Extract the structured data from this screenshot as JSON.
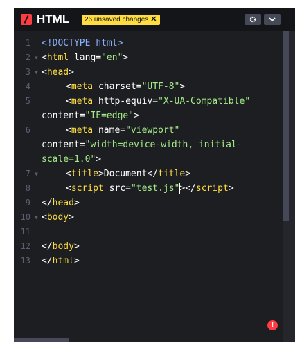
{
  "header": {
    "title": "HTML",
    "badge_text": "26 unsaved changes",
    "badge_close": "✕",
    "gear_icon": "⚙",
    "chevron_icon": "⌄"
  },
  "editor": {
    "lines": [
      {
        "num": "1",
        "fold": false,
        "segments": [
          [
            "d",
            "<!DOCTYPE html>"
          ]
        ]
      },
      {
        "num": "2",
        "fold": true,
        "segments": [
          [
            "p",
            "<"
          ],
          [
            "t",
            "html"
          ],
          [
            "a",
            " lang="
          ],
          [
            "s",
            "\"en\""
          ],
          [
            "p",
            ">"
          ]
        ]
      },
      {
        "num": "3",
        "fold": true,
        "segments": [
          [
            "p",
            "<"
          ],
          [
            "t",
            "head"
          ],
          [
            "p",
            ">"
          ]
        ]
      },
      {
        "num": "4",
        "fold": false,
        "indent": true,
        "segments": [
          [
            "p",
            "<"
          ],
          [
            "t",
            "meta"
          ],
          [
            "a",
            " charset="
          ],
          [
            "s",
            "\"UTF-8\""
          ],
          [
            "p",
            ">"
          ]
        ]
      },
      {
        "num": "5",
        "fold": false,
        "indent": true,
        "segments": [
          [
            "p",
            "<"
          ],
          [
            "t",
            "meta"
          ],
          [
            "a",
            " http-equiv="
          ],
          [
            "s",
            "\"X-UA-Compatible\""
          ],
          [
            "p",
            "\n"
          ],
          [
            "a",
            "content="
          ],
          [
            "s",
            "\"IE=edge\""
          ],
          [
            "p",
            ">"
          ]
        ]
      },
      {
        "num": "6",
        "fold": false,
        "indent": true,
        "segments": [
          [
            "p",
            "<"
          ],
          [
            "t",
            "meta"
          ],
          [
            "a",
            " name="
          ],
          [
            "s",
            "\"viewport\""
          ],
          [
            "p",
            "\n"
          ],
          [
            "a",
            "content="
          ],
          [
            "s",
            "\"width=device-width, initial-\nscale=1.0\""
          ],
          [
            "p",
            ">"
          ]
        ]
      },
      {
        "num": "7",
        "fold": true,
        "indent": true,
        "segments": [
          [
            "p",
            "<"
          ],
          [
            "t",
            "title"
          ],
          [
            "p",
            ">"
          ],
          [
            "a",
            "Document"
          ],
          [
            "p",
            "</"
          ],
          [
            "t",
            "title"
          ],
          [
            "p",
            ">"
          ]
        ]
      },
      {
        "num": "8",
        "fold": false,
        "indent": true,
        "segments": [
          [
            "p",
            "<"
          ],
          [
            "t",
            "script"
          ],
          [
            "a",
            " src="
          ],
          [
            "s",
            "\"test.js\""
          ],
          [
            "caret",
            ""
          ],
          [
            "p",
            ">"
          ],
          [
            "pu",
            "</"
          ],
          [
            "tu",
            "script"
          ],
          [
            "pu",
            ">"
          ]
        ]
      },
      {
        "num": "9",
        "fold": false,
        "segments": [
          [
            "p",
            "</"
          ],
          [
            "t",
            "head"
          ],
          [
            "p",
            ">"
          ]
        ]
      },
      {
        "num": "10",
        "fold": true,
        "segments": [
          [
            "p",
            "<"
          ],
          [
            "t",
            "body"
          ],
          [
            "p",
            ">"
          ]
        ]
      },
      {
        "num": "11",
        "fold": false,
        "segments": []
      },
      {
        "num": "12",
        "fold": false,
        "segments": [
          [
            "p",
            "</"
          ],
          [
            "t",
            "body"
          ],
          [
            "p",
            ">"
          ]
        ]
      },
      {
        "num": "13",
        "fold": false,
        "segments": [
          [
            "p",
            "</"
          ],
          [
            "t",
            "html"
          ],
          [
            "p",
            ">"
          ]
        ]
      }
    ]
  },
  "error_icon": "!"
}
